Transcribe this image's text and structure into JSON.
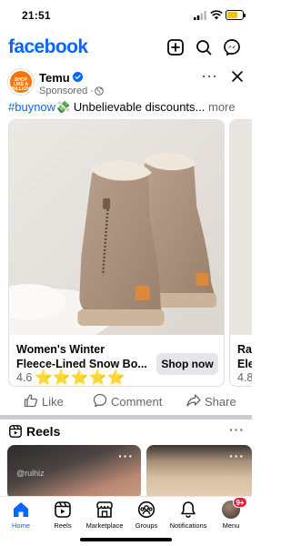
{
  "status_bar": {
    "time": "21:51"
  },
  "header": {
    "logo": "facebook",
    "icons": [
      "create-post-icon",
      "search-icon",
      "messenger-icon"
    ]
  },
  "post": {
    "page_name": "Temu",
    "avatar_text": "SHOP LIKE A BILLIONAIRE",
    "sponsored": "Sponsored ·",
    "caption": {
      "hashtag": "#buynow",
      "emoji": "💸",
      "text": " Unbelievable discounts...",
      "more": " more"
    },
    "cards": [
      {
        "title_line1": "Women's Winter",
        "title_line2": "Fleece-Lined Snow Bo...",
        "rating": "4.6",
        "stars": "⭐⭐⭐⭐⭐",
        "cta": "Shop now"
      },
      {
        "title_line1": "Rac",
        "title_line2": "Ele",
        "rating": "4.8"
      }
    ],
    "actions": {
      "like": "Like",
      "comment": "Comment",
      "share": "Share"
    }
  },
  "reels": {
    "title": "Reels",
    "tag": "@rulhiz"
  },
  "bottom_nav": {
    "items": [
      {
        "label": "Home",
        "icon": "home-icon",
        "active": true
      },
      {
        "label": "Reels",
        "icon": "reels-icon"
      },
      {
        "label": "Marketplace",
        "icon": "marketplace-icon"
      },
      {
        "label": "Groups",
        "icon": "groups-icon"
      },
      {
        "label": "Notifications",
        "icon": "bell-icon"
      },
      {
        "label": "Menu",
        "icon": "avatar",
        "badge": "9+"
      }
    ]
  },
  "colors": {
    "brand": "#0866ff",
    "temu_orange": "#fb7701",
    "star": "#f7b500",
    "badge": "#e41e3f"
  }
}
